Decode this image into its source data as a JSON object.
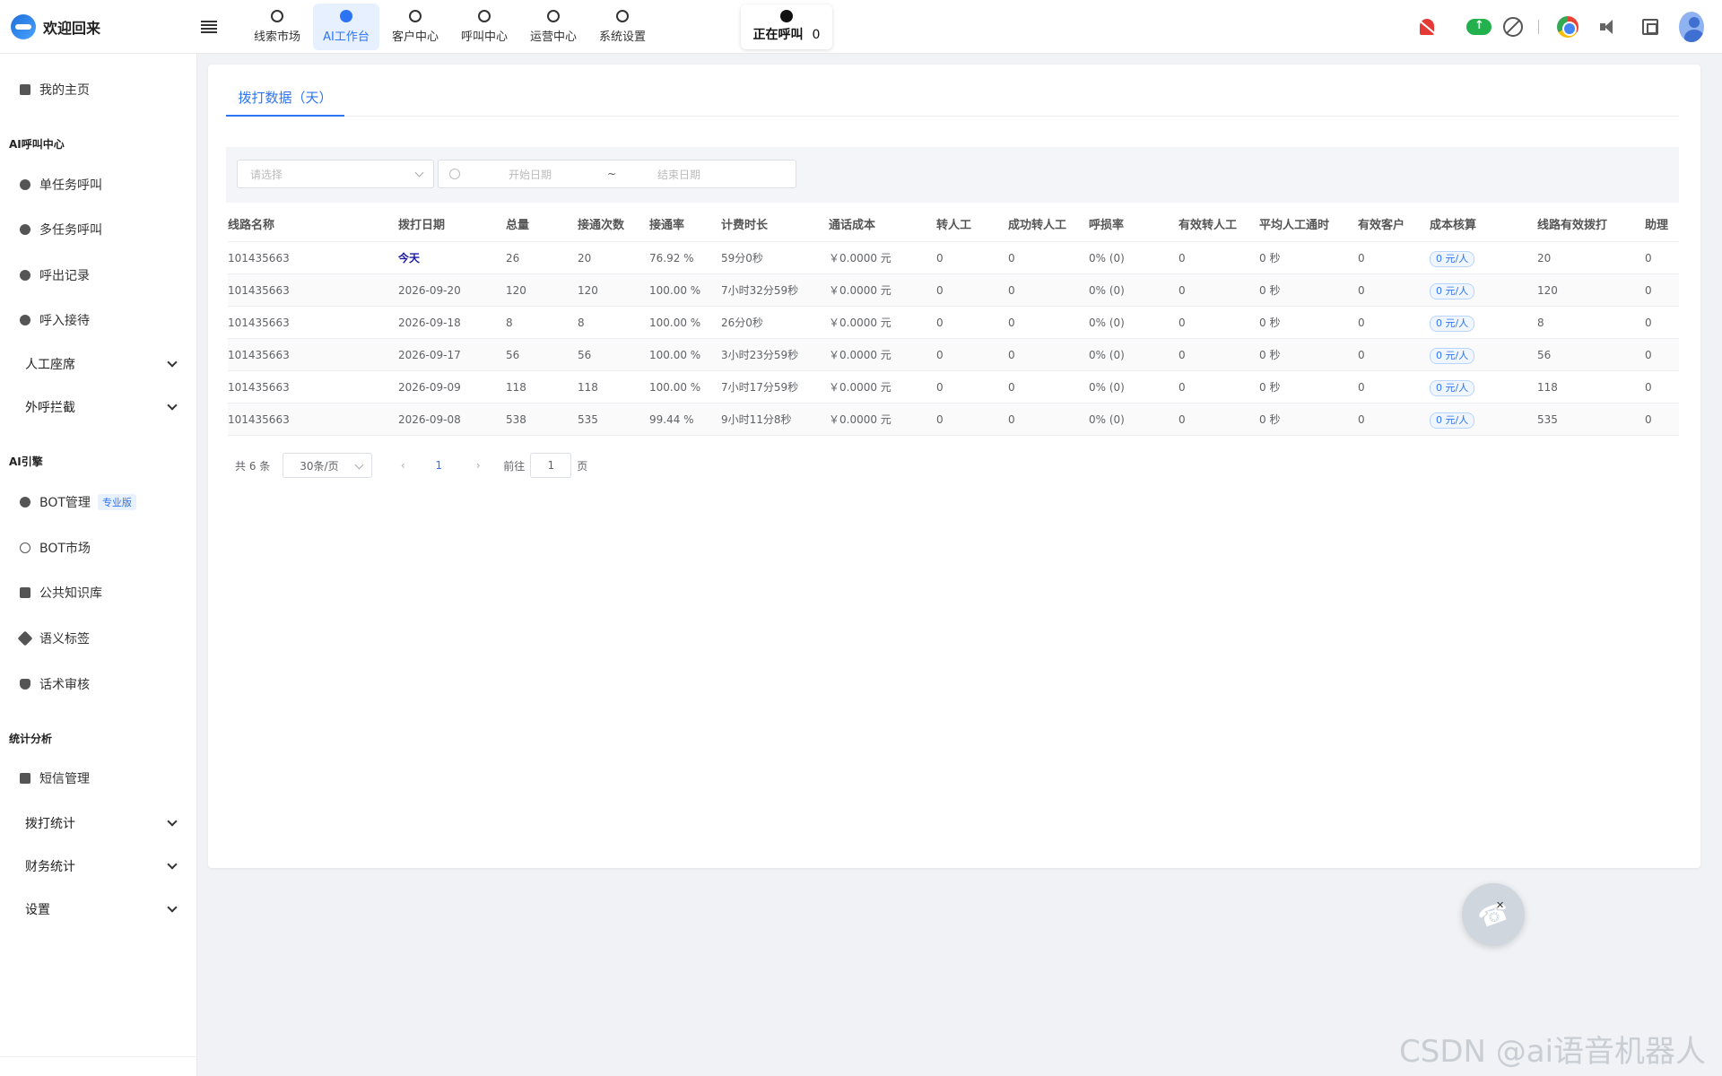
{
  "app": {
    "title": "欢迎回来"
  },
  "topnav": [
    {
      "label": "线索市场",
      "icon": "check-circle-icon",
      "active": false
    },
    {
      "label": "AI工作台",
      "icon": "ai-workbench-icon",
      "active": true
    },
    {
      "label": "客户中心",
      "icon": "users-icon",
      "active": false
    },
    {
      "label": "呼叫中心",
      "icon": "headset-icon",
      "active": false
    },
    {
      "label": "运营中心",
      "icon": "cycle-icon",
      "active": false
    },
    {
      "label": "系统设置",
      "icon": "gear-icon",
      "active": false
    }
  ],
  "calling": {
    "label": "正在呼叫",
    "count": "0"
  },
  "topright_icons": [
    "bell-off-icon",
    "cloud-upload-icon",
    "forbid-icon",
    "chrome-icon",
    "speaker-icon",
    "fullscreen-icon",
    "avatar-icon"
  ],
  "sidebar": {
    "home": "我的主页",
    "group_ai_call": "AI呼叫中心",
    "ai_call_items": [
      "单任务呼叫",
      "多任务呼叫",
      "呼出记录",
      "呼入接待"
    ],
    "sub_manual": "人工座席",
    "sub_intercept": "外呼拦截",
    "group_engine": "AI引擎",
    "bot_manage": "BOT管理",
    "bot_manage_tag": "专业版",
    "engine_items": [
      "BOT市场",
      "公共知识库",
      "语义标签",
      "话术审核"
    ],
    "group_stats": "统计分析",
    "sms": "短信管理",
    "sub_dial_stats": "拨打统计",
    "sub_finance": "财务统计",
    "sub_settings": "设置"
  },
  "tab": {
    "label": "拨打数据（天）"
  },
  "filter": {
    "select_placeholder": "请选择",
    "start_placeholder": "开始日期",
    "tilde": "~",
    "end_placeholder": "结束日期"
  },
  "table": {
    "headers": [
      "线路名称",
      "拨打日期",
      "总量",
      "接通次数",
      "接通率",
      "计费时长",
      "通话成本",
      "转人工",
      "成功转人工",
      "呼损率",
      "有效转人工",
      "平均人工通时",
      "有效客户",
      "成本核算",
      "线路有效拨打",
      "助理"
    ],
    "rows": [
      [
        "101435663",
        "今天",
        "26",
        "20",
        "76.92 %",
        "59分0秒",
        "￥0.0000 元",
        "0",
        "0",
        "0% (0)",
        "0",
        "0 秒",
        "0",
        "0 元/人",
        "20",
        "0"
      ],
      [
        "101435663",
        "2026-09-20",
        "120",
        "120",
        "100.00 %",
        "7小时32分59秒",
        "￥0.0000 元",
        "0",
        "0",
        "0% (0)",
        "0",
        "0 秒",
        "0",
        "0 元/人",
        "120",
        "0"
      ],
      [
        "101435663",
        "2026-09-18",
        "8",
        "8",
        "100.00 %",
        "26分0秒",
        "￥0.0000 元",
        "0",
        "0",
        "0% (0)",
        "0",
        "0 秒",
        "0",
        "0 元/人",
        "8",
        "0"
      ],
      [
        "101435663",
        "2026-09-17",
        "56",
        "56",
        "100.00 %",
        "3小时23分59秒",
        "￥0.0000 元",
        "0",
        "0",
        "0% (0)",
        "0",
        "0 秒",
        "0",
        "0 元/人",
        "56",
        "0"
      ],
      [
        "101435663",
        "2026-09-09",
        "118",
        "118",
        "100.00 %",
        "7小时17分59秒",
        "￥0.0000 元",
        "0",
        "0",
        "0% (0)",
        "0",
        "0 秒",
        "0",
        "0 元/人",
        "118",
        "0"
      ],
      [
        "101435663",
        "2026-09-08",
        "538",
        "535",
        "99.44 %",
        "9小时11分8秒",
        "￥0.0000 元",
        "0",
        "0",
        "0% (0)",
        "0",
        "0 秒",
        "0",
        "0 元/人",
        "535",
        "0"
      ]
    ]
  },
  "pager": {
    "total": "共 6 条",
    "page_size": "30条/页",
    "current": "1",
    "goto_label": "前往",
    "goto_value": "1",
    "page_unit": "页"
  },
  "watermark": "CSDN @ai语音机器人",
  "colors": {
    "primary": "#2d74f4",
    "alert": "#e53935",
    "success": "#22b14c"
  }
}
